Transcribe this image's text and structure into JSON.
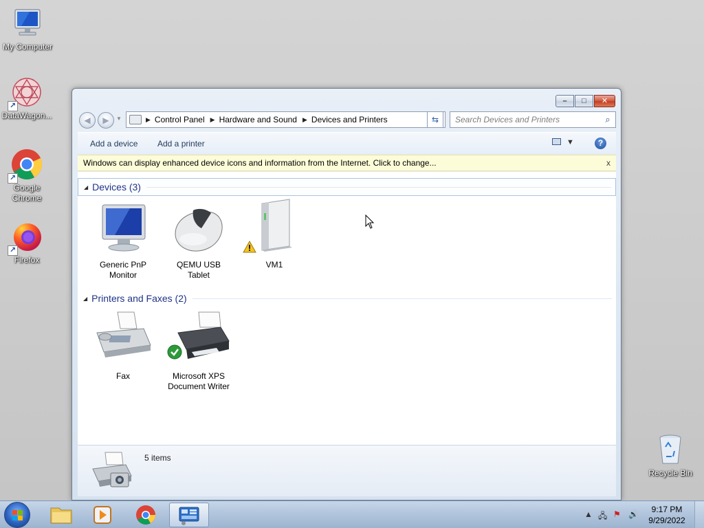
{
  "desktop": {
    "icons": [
      {
        "label": "My Computer"
      },
      {
        "label": "DataWagon..."
      },
      {
        "label": "Google Chrome"
      },
      {
        "label": "Firefox"
      },
      {
        "label": "Recycle Bin"
      }
    ]
  },
  "window": {
    "caption": {
      "minimize": "–",
      "maximize": "□",
      "close": "✕"
    },
    "breadcrumb": [
      "Control Panel",
      "Hardware and Sound",
      "Devices and Printers"
    ],
    "search_placeholder": "Search Devices and Printers",
    "commands": {
      "add_device": "Add a device",
      "add_printer": "Add a printer",
      "help": "?"
    },
    "info_bar": {
      "text": "Windows can display enhanced device icons and information from the Internet. Click to change...",
      "close": "x"
    },
    "groups": {
      "devices": {
        "title": "Devices (3)",
        "items": [
          {
            "name": "Generic PnP Monitor"
          },
          {
            "name": "QEMU USB Tablet"
          },
          {
            "name": "VM1",
            "warning": true
          }
        ]
      },
      "printers": {
        "title": "Printers and Faxes (2)",
        "items": [
          {
            "name": "Fax"
          },
          {
            "name": "Microsoft XPS Document Writer",
            "default": true
          }
        ]
      }
    },
    "details": {
      "count": "5 items"
    }
  },
  "taskbar": {
    "apps": [
      "windows-explorer",
      "windows-media-player",
      "google-chrome",
      "devices-and-printers"
    ],
    "clock": {
      "time": "9:17 PM",
      "date": "9/29/2022"
    }
  },
  "colors": {
    "accent": "#1e3287",
    "info_bar": "#fdfcd8",
    "close_button": "#c33d21"
  }
}
